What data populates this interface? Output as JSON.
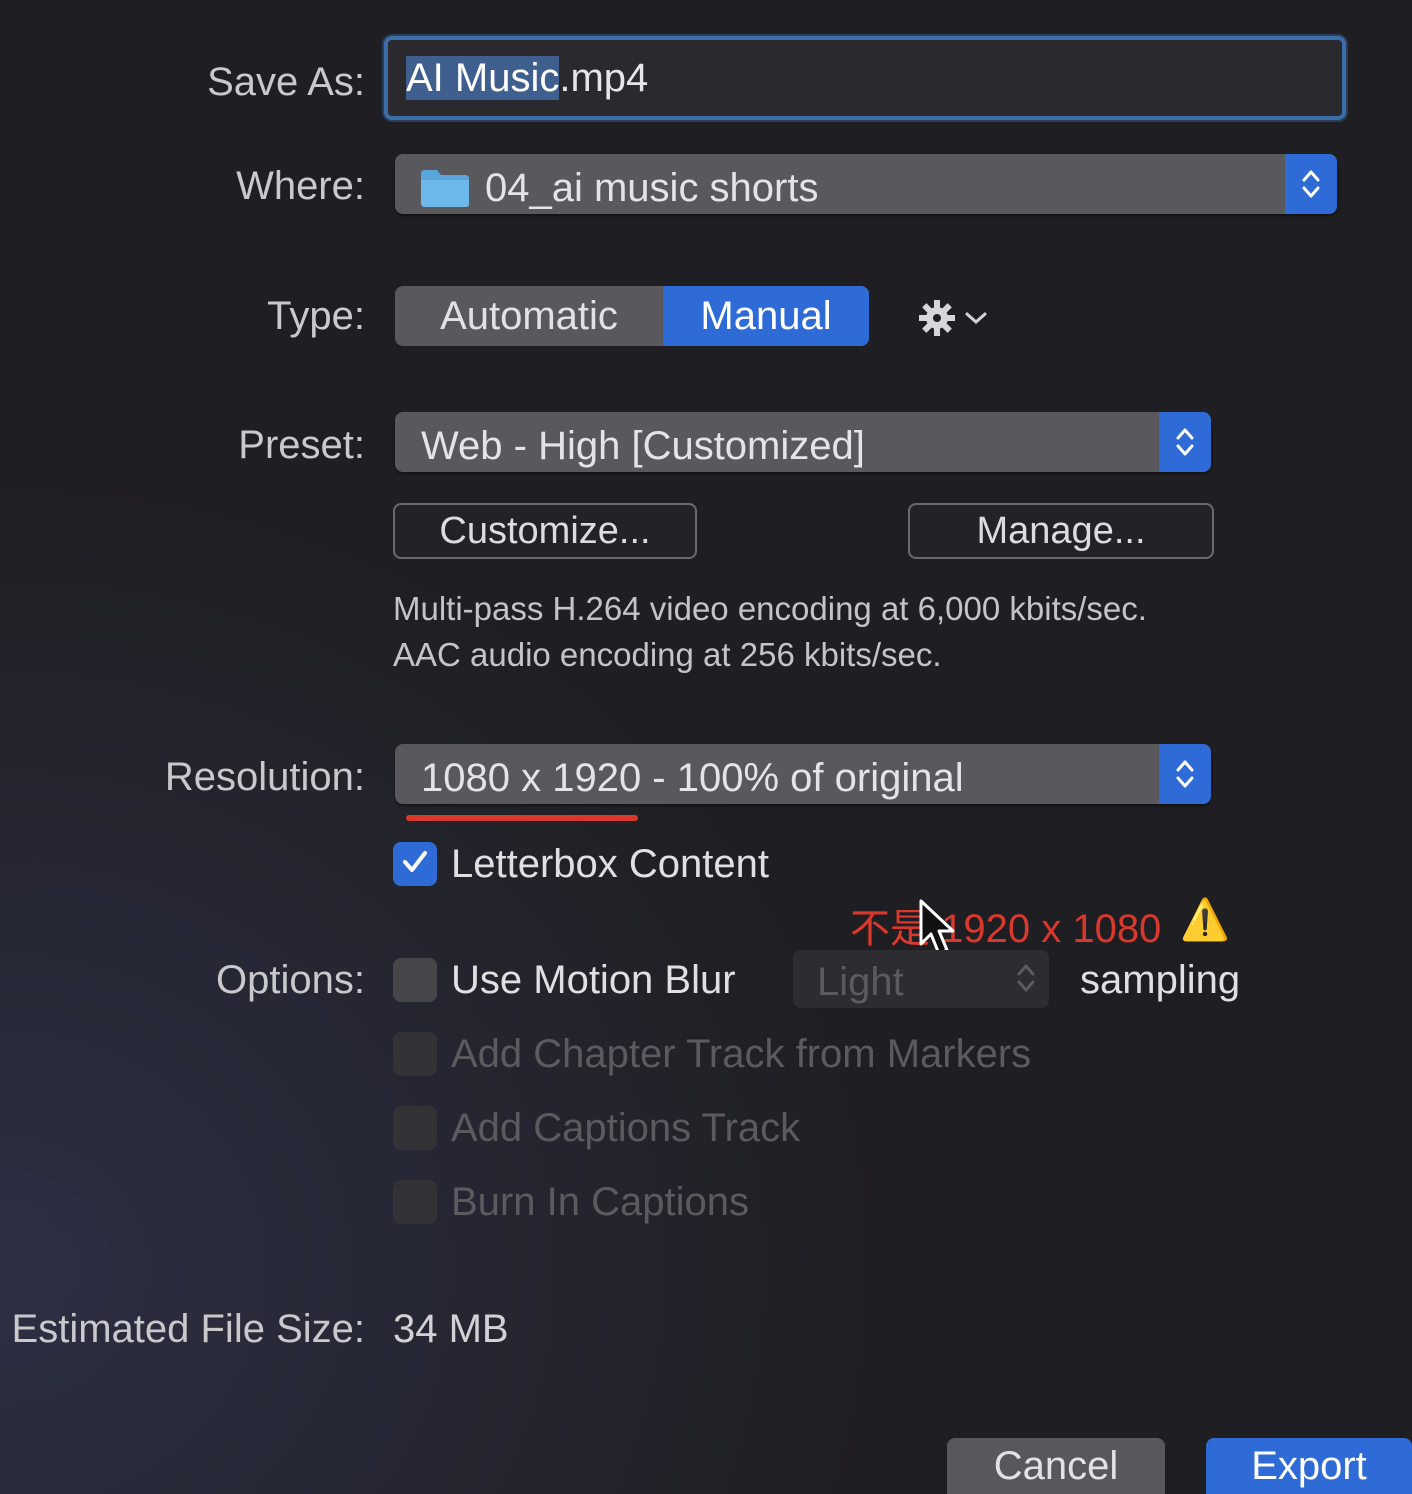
{
  "labels": {
    "save_as": "Save As:",
    "where": "Where:",
    "type": "Type:",
    "preset": "Preset:",
    "resolution": "Resolution:",
    "options": "Options:",
    "estimated_size": "Estimated File Size:"
  },
  "save_as": {
    "selected_part": "AI Music",
    "rest": ".mp4"
  },
  "where": {
    "folder": "04_ai music shorts"
  },
  "type": {
    "segments": [
      "Automatic",
      "Manual"
    ],
    "selected": "Manual"
  },
  "preset": {
    "value": "Web - High [Customized]"
  },
  "buttons": {
    "customize": "Customize...",
    "manage": "Manage...",
    "cancel": "Cancel",
    "export": "Export"
  },
  "description": {
    "line1": "Multi-pass H.264 video encoding at 6,000 kbits/sec.",
    "line2": "AAC audio encoding at 256 kbits/sec."
  },
  "resolution": {
    "value": "1080 x 1920 - 100% of original"
  },
  "letterbox": {
    "label": "Letterbox Content",
    "checked": true
  },
  "annotation": {
    "text": "不是 1920 x 1080",
    "icon": "⚠️"
  },
  "options": {
    "motion_blur": {
      "label": "Use Motion Blur",
      "checked": false
    },
    "sampling_popup": "Light",
    "sampling_label": "sampling",
    "chapter": {
      "label": "Add Chapter Track from Markers",
      "enabled": false
    },
    "captions_track": {
      "label": "Add Captions Track",
      "enabled": false
    },
    "burn_captions": {
      "label": "Burn In Captions",
      "enabled": false
    }
  },
  "estimated_file_size": "34 MB",
  "colors": {
    "accent": "#2f6bd6",
    "annotation_red": "#d9382c",
    "background": "#1f1e22"
  }
}
